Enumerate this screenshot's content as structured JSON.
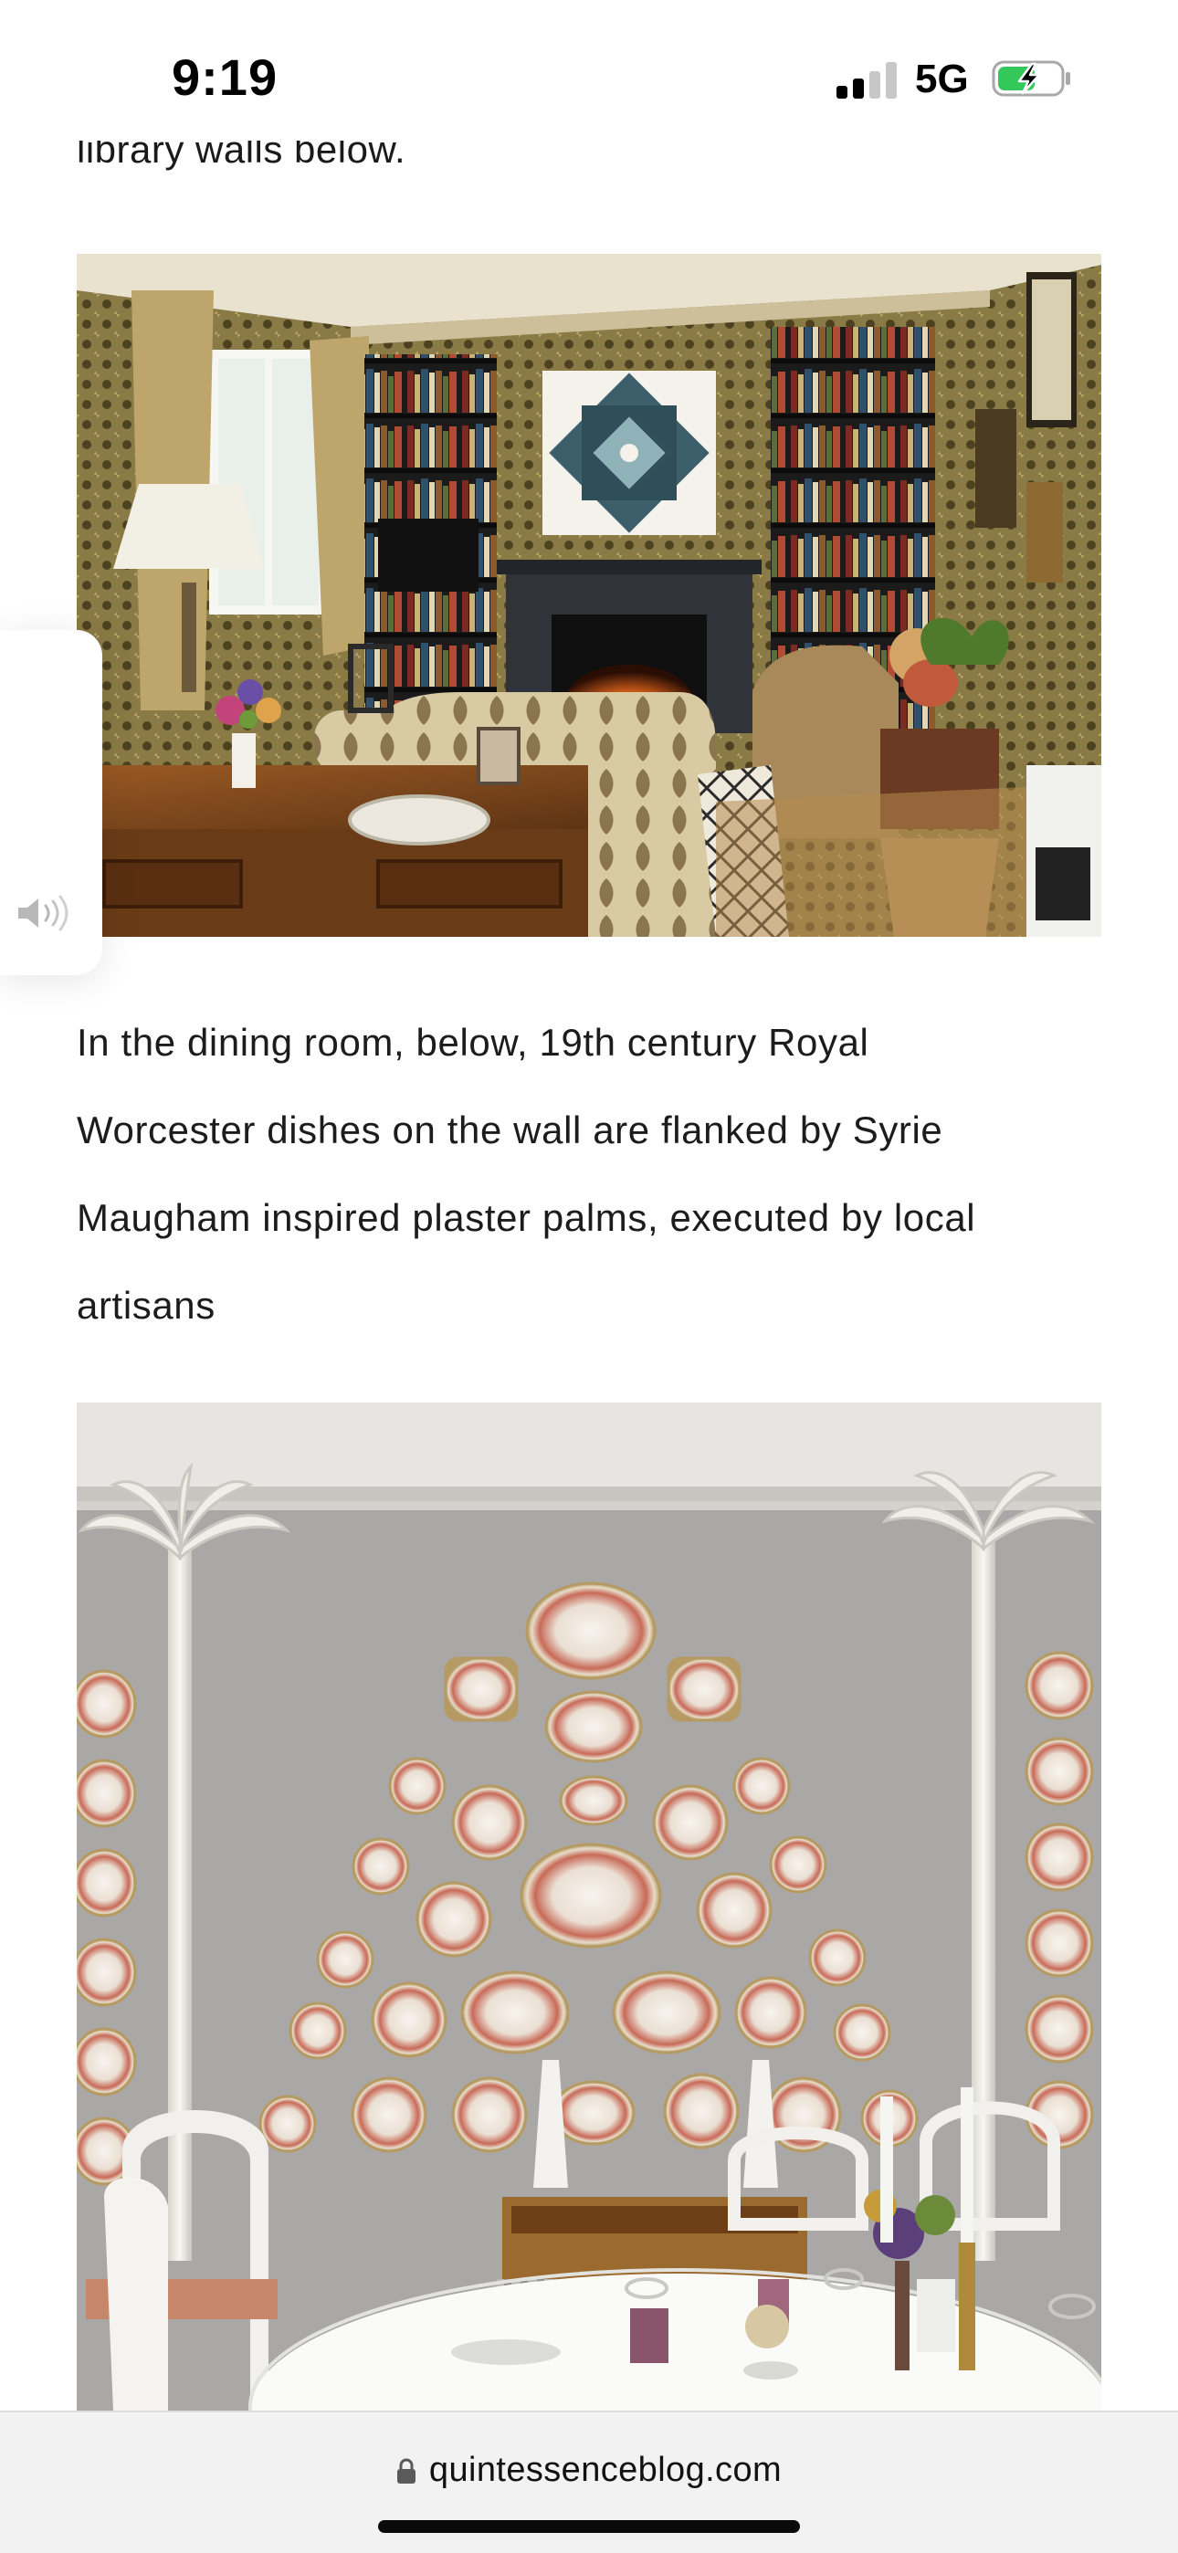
{
  "status_bar": {
    "time": "9:19",
    "network": "5G",
    "signal_bars_active": 2,
    "signal_bars_total": 4,
    "battery_charging": true,
    "battery_color": "#34c759"
  },
  "article": {
    "cut_off_text": "library walls below.",
    "caption": {
      "lines": [
        "In the dining room, below, 19th century Royal",
        "Worcester dishes on the wall are flanked by Syrie",
        "Maugham inspired plaster palms, executed by local",
        "artisans"
      ]
    },
    "images": [
      {
        "name": "library-photo",
        "subject": "library with bookshelves, fireplace and desk"
      },
      {
        "name": "dining-room-photo",
        "subject": "dining room wall with plates and plaster palms"
      }
    ]
  },
  "audio_tab": {
    "icon": "speaker-icon"
  },
  "url_bar": {
    "url": "quintessenceblog.com",
    "icon": "lock-icon"
  }
}
